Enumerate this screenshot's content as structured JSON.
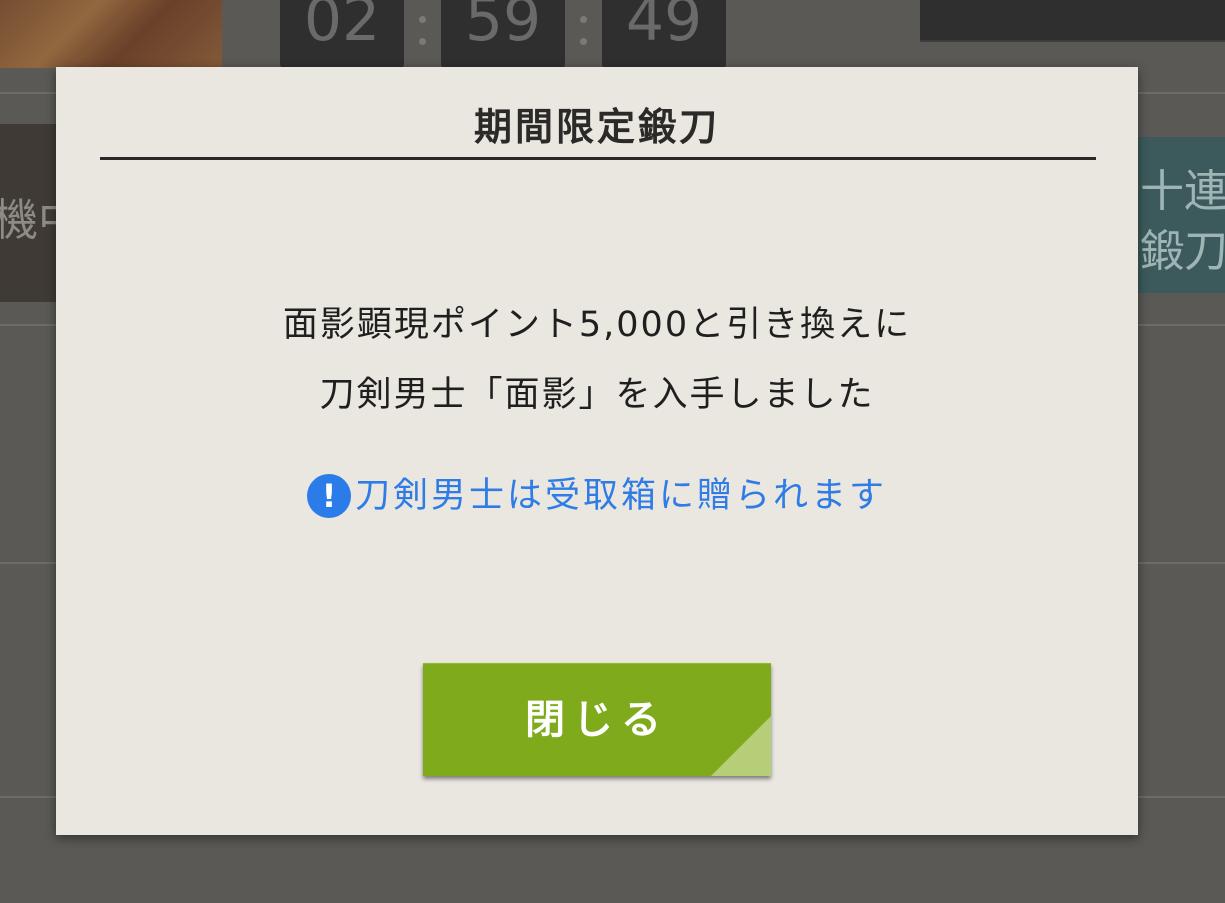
{
  "background": {
    "timer": {
      "hours": "02",
      "minutes": "59",
      "seconds": "49"
    },
    "left_panel_text": "機中",
    "right_panel_lines": [
      "十連",
      "鍛刀"
    ]
  },
  "dialog": {
    "title": "期間限定鍛刀",
    "message_lines": [
      "面影顕現ポイント5,000と引き換えに",
      "刀剣男士「面影」を入手しました"
    ],
    "notice_icon": "exclamation-icon",
    "notice_icon_glyph": "!",
    "notice_text": "刀剣男士は受取箱に贈られます",
    "close_label": "閉じる"
  },
  "colors": {
    "dialog_background": "#eae7e1",
    "title_rule": "#2b2a28",
    "notice_blue": "#2f7ce6",
    "close_button_green": "#7faa1b",
    "close_button_corner": "#b6ce77",
    "overlay_dim": "#5a5955"
  }
}
